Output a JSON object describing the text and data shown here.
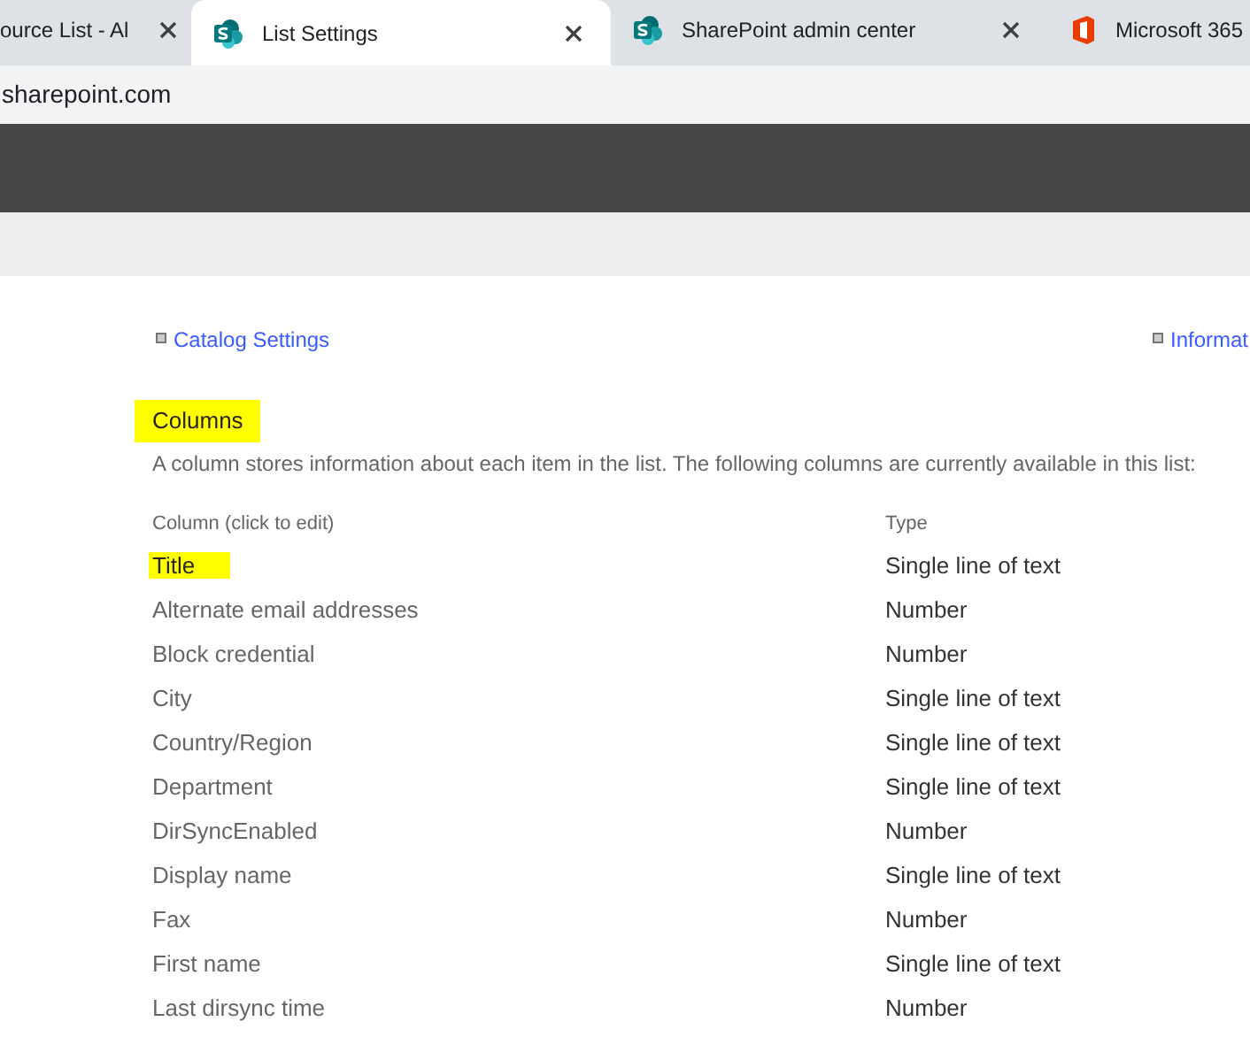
{
  "browser_tabs": [
    {
      "title": "ource List - Al",
      "selected": false
    },
    {
      "title": "List Settings",
      "selected": true
    },
    {
      "title": "SharePoint admin center",
      "selected": false
    },
    {
      "title": "Microsoft 365",
      "selected": false
    }
  ],
  "address": "sharepoint.com",
  "links": [
    {
      "label": "Catalog Settings"
    },
    {
      "label": "Informat"
    }
  ],
  "columns_section": {
    "heading": "Columns",
    "highlighted": true,
    "description": "A column stores information about each item in the list. The following columns are currently available in this list:",
    "table_headers": [
      "Column (click to edit)",
      "Type"
    ],
    "rows": [
      {
        "name": "Title",
        "type": "Single line of text",
        "highlighted": true
      },
      {
        "name": "Alternate email addresses",
        "type": "Number",
        "highlighted": false
      },
      {
        "name": "Block credential",
        "type": "Number",
        "highlighted": false
      },
      {
        "name": "City",
        "type": "Single line of text",
        "highlighted": false
      },
      {
        "name": "Country/Region",
        "type": "Single line of text",
        "highlighted": false
      },
      {
        "name": "Department",
        "type": "Single line of text",
        "highlighted": false
      },
      {
        "name": "DirSyncEnabled",
        "type": "Number",
        "highlighted": false
      },
      {
        "name": "Display name",
        "type": "Single line of text",
        "highlighted": false
      },
      {
        "name": "Fax",
        "type": "Number",
        "highlighted": false
      },
      {
        "name": "First name",
        "type": "Single line of text",
        "highlighted": false
      },
      {
        "name": "Last dirsync time",
        "type": "Number",
        "highlighted": false
      }
    ]
  }
}
